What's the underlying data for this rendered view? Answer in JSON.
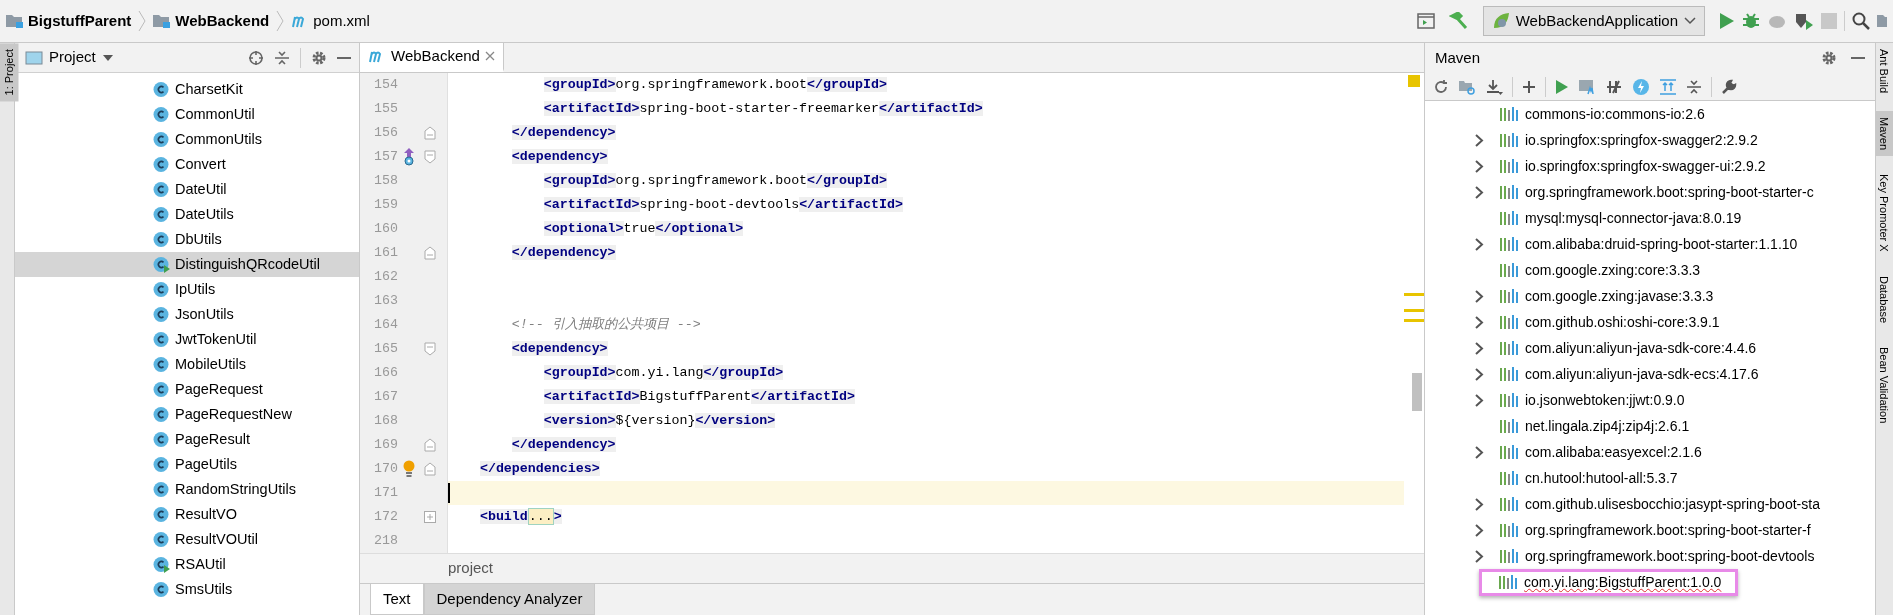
{
  "breadcrumbs": [
    {
      "label": "BigstuffParent",
      "kind": "folder"
    },
    {
      "label": "WebBackend",
      "kind": "folder"
    },
    {
      "label": "pom.xml",
      "kind": "maven"
    }
  ],
  "run_toolbar": {
    "config": "WebBackendApplication",
    "stop_disabled": true
  },
  "left_strip_tabs": [
    {
      "label": "1: Project",
      "selected": true
    }
  ],
  "project_panel": {
    "title": "Project",
    "items": [
      {
        "label": "CharsetKit",
        "runnable": false,
        "selected": false
      },
      {
        "label": "CommonUtil",
        "runnable": false,
        "selected": false
      },
      {
        "label": "CommonUtils",
        "runnable": false,
        "selected": false
      },
      {
        "label": "Convert",
        "runnable": false,
        "selected": false
      },
      {
        "label": "DateUtil",
        "runnable": false,
        "selected": false
      },
      {
        "label": "DateUtils",
        "runnable": false,
        "selected": false
      },
      {
        "label": "DbUtils",
        "runnable": false,
        "selected": false
      },
      {
        "label": "DistinguishQRcodeUtil",
        "runnable": true,
        "selected": true
      },
      {
        "label": "IpUtils",
        "runnable": false,
        "selected": false
      },
      {
        "label": "JsonUtils",
        "runnable": false,
        "selected": false
      },
      {
        "label": "JwtTokenUtil",
        "runnable": false,
        "selected": false
      },
      {
        "label": "MobileUtils",
        "runnable": false,
        "selected": false
      },
      {
        "label": "PageRequest",
        "runnable": false,
        "selected": false
      },
      {
        "label": "PageRequestNew",
        "runnable": false,
        "selected": false
      },
      {
        "label": "PageResult",
        "runnable": false,
        "selected": false
      },
      {
        "label": "PageUtils",
        "runnable": false,
        "selected": false
      },
      {
        "label": "RandomStringUtils",
        "runnable": false,
        "selected": false
      },
      {
        "label": "ResultVO",
        "runnable": false,
        "selected": false
      },
      {
        "label": "ResultVOUtil",
        "runnable": false,
        "selected": false
      },
      {
        "label": "RSAUtil",
        "runnable": true,
        "selected": false
      },
      {
        "label": "SmsUtils",
        "runnable": false,
        "selected": false
      }
    ]
  },
  "editor": {
    "tabs": [
      {
        "label": "WebBackend",
        "selected": true
      }
    ],
    "lines": [
      {
        "number": "154",
        "current": false,
        "tokens": [
          {
            "kind": "tag",
            "text": "            <groupId>"
          },
          {
            "kind": "plain",
            "text": "org.springframework.boot"
          },
          {
            "kind": "tag",
            "text": "</groupId>"
          }
        ]
      },
      {
        "number": "155",
        "current": false,
        "tokens": [
          {
            "kind": "tag",
            "text": "            <artifactId>"
          },
          {
            "kind": "plain",
            "text": "spring-boot-starter-freemarker"
          },
          {
            "kind": "tag",
            "text": "</artifactId>"
          }
        ]
      },
      {
        "number": "156",
        "current": false,
        "gutter_icons": [
          {
            "kind": "fold_end"
          }
        ],
        "tokens": [
          {
            "kind": "tag",
            "text": "        </dependency>"
          }
        ]
      },
      {
        "number": "157",
        "current": false,
        "gutter_icons": [
          {
            "kind": "override"
          },
          {
            "kind": "fold_start"
          }
        ],
        "tokens": [
          {
            "kind": "tag",
            "text": "        <dependency>"
          }
        ]
      },
      {
        "number": "158",
        "current": false,
        "tokens": [
          {
            "kind": "tag",
            "text": "            <groupId>"
          },
          {
            "kind": "plain",
            "text": "org.springframework.boot"
          },
          {
            "kind": "tag",
            "text": "</groupId>"
          }
        ]
      },
      {
        "number": "159",
        "current": false,
        "tokens": [
          {
            "kind": "tag",
            "text": "            <artifactId>"
          },
          {
            "kind": "plain",
            "text": "spring-boot-devtools"
          },
          {
            "kind": "tag",
            "text": "</artifactId>"
          }
        ]
      },
      {
        "number": "160",
        "current": false,
        "tokens": [
          {
            "kind": "tag",
            "text": "            <optional>"
          },
          {
            "kind": "plain",
            "text": "true"
          },
          {
            "kind": "tag",
            "text": "</optional>"
          }
        ]
      },
      {
        "number": "161",
        "current": false,
        "gutter_icons": [
          {
            "kind": "fold_end"
          }
        ],
        "tokens": [
          {
            "kind": "tag",
            "text": "        </dependency>"
          }
        ]
      },
      {
        "number": "162",
        "current": false
      },
      {
        "number": "163",
        "current": false
      },
      {
        "number": "164",
        "current": false,
        "tokens": [
          {
            "kind": "comment",
            "text": "        <!-- 引入抽取的公共项目 -->"
          }
        ]
      },
      {
        "number": "165",
        "current": false,
        "gutter_icons": [
          {
            "kind": "fold_start"
          }
        ],
        "tokens": [
          {
            "kind": "tag",
            "text": "        <dependency>"
          }
        ]
      },
      {
        "number": "166",
        "current": false,
        "tokens": [
          {
            "kind": "tag",
            "text": "            <groupId>"
          },
          {
            "kind": "plain",
            "text": "com.yi.lang"
          },
          {
            "kind": "tag",
            "text": "</groupId>"
          }
        ]
      },
      {
        "number": "167",
        "current": false,
        "tokens": [
          {
            "kind": "tag",
            "text": "            <artifactId>"
          },
          {
            "kind": "plain",
            "text": "BigstuffParent"
          },
          {
            "kind": "tag",
            "text": "</artifactId>"
          }
        ]
      },
      {
        "number": "168",
        "current": false,
        "tokens": [
          {
            "kind": "tag",
            "text": "            <version>"
          },
          {
            "kind": "plain",
            "text": "${version}"
          },
          {
            "kind": "tag",
            "text": "</version>"
          }
        ]
      },
      {
        "number": "169",
        "current": false,
        "gutter_icons": [
          {
            "kind": "fold_end"
          }
        ],
        "tokens": [
          {
            "kind": "tag",
            "text": "        </dependency>"
          }
        ]
      },
      {
        "number": "170",
        "current": false,
        "gutter_icons": [
          {
            "kind": "bulb"
          },
          {
            "kind": "fold_end"
          }
        ],
        "tokens": [
          {
            "kind": "tag",
            "text": "    </dependencies>"
          }
        ]
      },
      {
        "number": "171",
        "current": true
      },
      {
        "number": "172",
        "current": false,
        "gutter_icons": [
          {
            "kind": "fold_collapsed"
          }
        ],
        "tokens": [
          {
            "kind": "tag",
            "text": "    <build"
          },
          {
            "kind": "fold",
            "text": "..."
          },
          {
            "kind": "tag",
            "text": ">"
          }
        ]
      },
      {
        "number": "218",
        "current": false
      }
    ],
    "breadcrumb": "project",
    "bottom_tabs": [
      {
        "label": "Text",
        "selected": true
      },
      {
        "label": "Dependency Analyzer",
        "selected": false
      }
    ]
  },
  "maven": {
    "title": "Maven",
    "items": [
      {
        "label": "commons-io:commons-io:2.6",
        "expandable": false,
        "highlighted": false,
        "error": false
      },
      {
        "label": "io.springfox:springfox-swagger2:2.9.2",
        "expandable": true,
        "highlighted": false,
        "error": false
      },
      {
        "label": "io.springfox:springfox-swagger-ui:2.9.2",
        "expandable": true,
        "highlighted": false,
        "error": false
      },
      {
        "label": "org.springframework.boot:spring-boot-starter-c",
        "expandable": true,
        "highlighted": false,
        "error": false
      },
      {
        "label": "mysql:mysql-connector-java:8.0.19",
        "expandable": false,
        "highlighted": false,
        "error": false
      },
      {
        "label": "com.alibaba:druid-spring-boot-starter:1.1.10",
        "expandable": true,
        "highlighted": false,
        "error": false
      },
      {
        "label": "com.google.zxing:core:3.3.3",
        "expandable": false,
        "highlighted": false,
        "error": false
      },
      {
        "label": "com.google.zxing:javase:3.3.3",
        "expandable": true,
        "highlighted": false,
        "error": false
      },
      {
        "label": "com.github.oshi:oshi-core:3.9.1",
        "expandable": true,
        "highlighted": false,
        "error": false
      },
      {
        "label": "com.aliyun:aliyun-java-sdk-core:4.4.6",
        "expandable": true,
        "highlighted": false,
        "error": false
      },
      {
        "label": "com.aliyun:aliyun-java-sdk-ecs:4.17.6",
        "expandable": true,
        "highlighted": false,
        "error": false
      },
      {
        "label": "io.jsonwebtoken:jjwt:0.9.0",
        "expandable": true,
        "highlighted": false,
        "error": false
      },
      {
        "label": "net.lingala.zip4j:zip4j:2.6.1",
        "expandable": false,
        "highlighted": false,
        "error": false
      },
      {
        "label": "com.alibaba:easyexcel:2.1.6",
        "expandable": true,
        "highlighted": false,
        "error": false
      },
      {
        "label": "cn.hutool:hutool-all:5.3.7",
        "expandable": false,
        "highlighted": false,
        "error": false
      },
      {
        "label": "com.github.ulisesbocchio:jasypt-spring-boot-sta",
        "expandable": true,
        "highlighted": false,
        "error": false
      },
      {
        "label": "org.springframework.boot:spring-boot-starter-f",
        "expandable": true,
        "highlighted": false,
        "error": false
      },
      {
        "label": "org.springframework.boot:spring-boot-devtools",
        "expandable": true,
        "highlighted": false,
        "error": false
      },
      {
        "label": "com.yi.lang:BigstuffParent:1.0.0",
        "expandable": false,
        "highlighted": true,
        "error": true
      }
    ]
  },
  "right_strip_tabs": [
    {
      "label": "Ant Build",
      "selected": false
    },
    {
      "label": "Maven",
      "selected": true
    },
    {
      "label": "Key Promoter X",
      "selected": false
    },
    {
      "label": "Database",
      "selected": false
    },
    {
      "label": "Bean Validation",
      "selected": false
    }
  ]
}
